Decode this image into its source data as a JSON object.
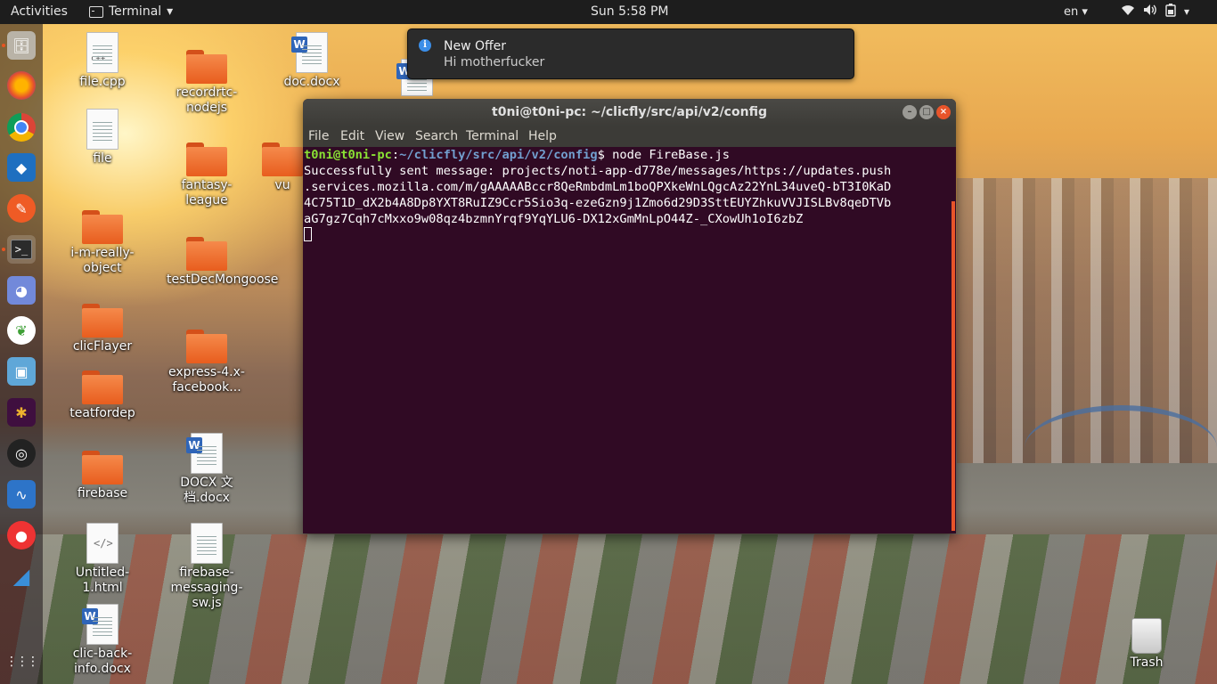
{
  "topbar": {
    "activities": "Activities",
    "app_name": "Terminal",
    "app_menu_arrow": "▾",
    "clock": "Sun  5:58 PM",
    "language": "en",
    "language_arrow": "▾",
    "system_icons": [
      "wifi-icon",
      "volume-icon",
      "battery-icon",
      "system-menu-arrow"
    ]
  },
  "dock": {
    "items": [
      {
        "name": "files",
        "glyph": "🗄"
      },
      {
        "name": "firefox",
        "glyph": "🦊"
      },
      {
        "name": "chrome",
        "glyph": "◉"
      },
      {
        "name": "vscode",
        "glyph": "◆"
      },
      {
        "name": "postman",
        "glyph": "✎"
      },
      {
        "name": "terminal",
        "glyph": ">_"
      },
      {
        "name": "discord",
        "glyph": "◕"
      },
      {
        "name": "mongodb-compass",
        "glyph": "❦"
      },
      {
        "name": "virtualbox",
        "glyph": "▣"
      },
      {
        "name": "slack",
        "glyph": "✱"
      },
      {
        "name": "obs",
        "glyph": "◎"
      },
      {
        "name": "system-monitor",
        "glyph": "∿"
      },
      {
        "name": "chat",
        "glyph": "●"
      },
      {
        "name": "wireshark",
        "glyph": "◢"
      },
      {
        "name": "show-applications",
        "glyph": "⋮⋮"
      }
    ]
  },
  "desktop": {
    "icons": [
      {
        "label": "file.cpp",
        "type": "code-file"
      },
      {
        "label": "recordrtc-nodejs",
        "type": "folder"
      },
      {
        "label": "doc.docx",
        "type": "word"
      },
      {
        "label": "file",
        "type": "text"
      },
      {
        "label": "fantasy-league",
        "type": "folder"
      },
      {
        "label": "vu",
        "type": "folder"
      },
      {
        "label": "i-m-really-object",
        "type": "folder"
      },
      {
        "label": "testDecMongoose",
        "type": "folder"
      },
      {
        "label": "clicFlayer",
        "type": "folder"
      },
      {
        "label": "express-4.x-facebook...",
        "type": "folder"
      },
      {
        "label": "teatfordep",
        "type": "folder"
      },
      {
        "label": "DOCX 文档.docx",
        "type": "word"
      },
      {
        "label": "firebase",
        "type": "folder"
      },
      {
        "label": "Untitled-1.html",
        "type": "html"
      },
      {
        "label": "firebase-messaging-sw.js",
        "type": "text"
      },
      {
        "label": "clic-back-info.docx",
        "type": "word"
      },
      {
        "label": "Trash",
        "type": "trash"
      }
    ]
  },
  "notification": {
    "title": "New Offer",
    "body": "Hi motherfucker"
  },
  "terminal": {
    "window_title": "t0ni@t0ni-pc: ~/clicfly/src/api/v2/config",
    "menu": [
      "File",
      "Edit",
      "View",
      "Search",
      "Terminal",
      "Help"
    ],
    "prompt_user": "t0ni@t0ni-pc",
    "prompt_sep": ":",
    "prompt_path": "~/clicfly/src/api/v2/config",
    "prompt_end": "$ ",
    "command": "node FireBase.js",
    "output_lines": [
      "Successfully sent message: projects/noti-app-d778e/messages/https://updates.push",
      ".services.mozilla.com/m/gAAAAABccr8QeRmbdmLm1boQPXkeWnLQgcAz22YnL34uveQ-bT3I0KaD",
      "4C75T1D_dX2b4A8Dp8YXT8RuIZ9Ccr5Sio3q-ezeGzn9j1Zmo6d29D3SttEUYZhkuVVJISLBv8qeDTVb",
      "aG7gz7Cqh7cMxxo9w08qz4bzmnYrqf9YqYLU6-DX12xGmMnLpO44Z-_CXowUh1oI6zbZ"
    ]
  }
}
